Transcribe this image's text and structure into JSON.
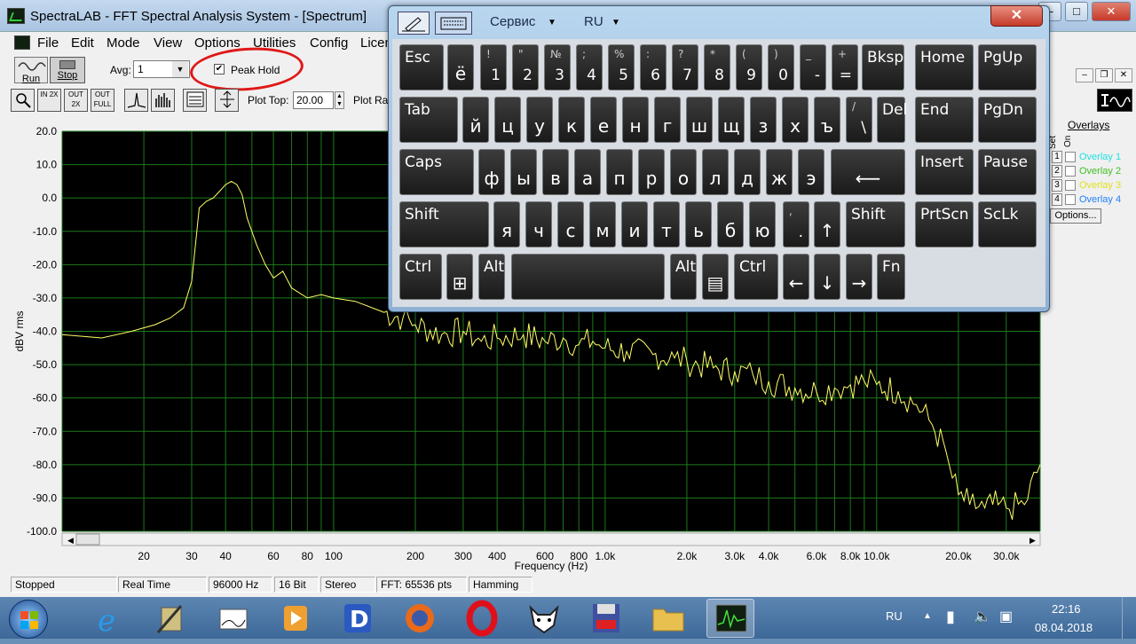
{
  "window": {
    "title": "SpectraLAB - FFT Spectral Analysis System - [Spectrum]",
    "min": "–",
    "max": "□",
    "close": "✕"
  },
  "menu": [
    "File",
    "Edit",
    "Mode",
    "View",
    "Options",
    "Utilities",
    "Config",
    "Licen"
  ],
  "toolbar": {
    "run": "Run",
    "stop": "Stop",
    "avg_label": "Avg:",
    "avg_value": "1",
    "peak_hold_label": "Peak Hold",
    "peak_hold_checked": "✔",
    "plot_top_label": "Plot Top:",
    "plot_top_value": "20.00",
    "plot_range_label": "Plot Ra",
    "zoom_buttons": [
      "IN 2X",
      "OUT 2X",
      "OUT FULL"
    ]
  },
  "overlays": {
    "header": "Overlays",
    "set_label": "Set",
    "on_label": "On",
    "items": [
      {
        "num": "1",
        "label": "Overlay 1",
        "color": "#20e0e0"
      },
      {
        "num": "2",
        "label": "Overlay 2",
        "color": "#40c020"
      },
      {
        "num": "3",
        "label": "Overlay 3",
        "color": "#e0e020"
      },
      {
        "num": "4",
        "label": "Overlay 4",
        "color": "#2080ff"
      }
    ],
    "options_label": "Options..."
  },
  "chart_data": {
    "type": "line",
    "ylabel": "dBV rms",
    "xlabel": "Frequency (Hz)",
    "ylim": [
      -100,
      20
    ],
    "xlim": [
      10,
      40000
    ],
    "xscale": "log",
    "y_ticks": [
      "20.0",
      "10.0",
      "0.0",
      "-10.0",
      "-20.0",
      "-30.0",
      "-40.0",
      "-50.0",
      "-60.0",
      "-70.0",
      "-80.0",
      "-90.0",
      "-100.0"
    ],
    "x_ticks": [
      {
        "v": 20,
        "label": "20"
      },
      {
        "v": 30,
        "label": "30"
      },
      {
        "v": 40,
        "label": "40"
      },
      {
        "v": 60,
        "label": "60"
      },
      {
        "v": 80,
        "label": "80"
      },
      {
        "v": 100,
        "label": "100"
      },
      {
        "v": 200,
        "label": "200"
      },
      {
        "v": 300,
        "label": "300"
      },
      {
        "v": 400,
        "label": "400"
      },
      {
        "v": 600,
        "label": "600"
      },
      {
        "v": 800,
        "label": "800"
      },
      {
        "v": 1000,
        "label": "1.0k"
      },
      {
        "v": 2000,
        "label": "2.0k"
      },
      {
        "v": 3000,
        "label": "3.0k"
      },
      {
        "v": 4000,
        "label": "4.0k"
      },
      {
        "v": 6000,
        "label": "6.0k"
      },
      {
        "v": 8000,
        "label": "8.0k"
      },
      {
        "v": 10000,
        "label": "10.0k"
      },
      {
        "v": 20000,
        "label": "20.0k"
      },
      {
        "v": 30000,
        "label": "30.0k"
      }
    ],
    "grid": true,
    "series": [
      {
        "color": "#ffff66",
        "x": [
          10,
          14,
          18,
          22,
          25,
          28,
          30,
          32,
          34,
          36,
          38,
          40,
          42,
          44,
          46,
          48,
          52,
          56,
          60,
          65,
          70,
          80,
          90,
          100,
          120,
          150,
          180,
          200,
          250,
          300,
          350,
          400,
          500,
          600,
          700,
          800,
          900,
          1000,
          1200,
          1500,
          1800,
          2000,
          2500,
          3000,
          3500,
          4000,
          5000,
          6000,
          7000,
          8000,
          9000,
          10000,
          12000,
          14000,
          16000,
          18000,
          19000,
          20000,
          22000,
          25000,
          28000,
          30000,
          35000,
          40000
        ],
        "y": [
          -41,
          -42,
          -40,
          -38,
          -36,
          -33,
          -25,
          -3,
          -1,
          0,
          2,
          4,
          5,
          4,
          1,
          -6,
          -14,
          -20,
          -24,
          -22,
          -27,
          -30,
          -29,
          -30,
          -31,
          -34,
          -36,
          -38,
          -41,
          -40,
          -43,
          -42,
          -41,
          -43,
          -42,
          -44,
          -43,
          -45,
          -46,
          -47,
          -48,
          -49,
          -51,
          -52,
          -53,
          -55,
          -57,
          -58,
          -57,
          -56,
          -55,
          -56,
          -58,
          -62,
          -68,
          -76,
          -84,
          -89,
          -92,
          -93,
          -92,
          -93,
          -92,
          -80
        ]
      }
    ]
  },
  "status": [
    "Stopped",
    "Real Time",
    "96000 Hz",
    "16 Bit",
    "Stereo",
    "FFT: 65536 pts",
    "Hamming"
  ],
  "osk": {
    "menu1": "Сервис",
    "menu2": "RU",
    "close": "✕",
    "rows": [
      [
        {
          "m": "Esc"
        },
        {
          "m": "ё"
        },
        {
          "t": "!",
          "b": "1"
        },
        {
          "t": "\"",
          "b": "2"
        },
        {
          "t": "№",
          "b": "3"
        },
        {
          "t": ";",
          "b": "4"
        },
        {
          "t": "%",
          "b": "5"
        },
        {
          "t": ":",
          "b": "6"
        },
        {
          "t": "?",
          "b": "7"
        },
        {
          "t": "*",
          "b": "8"
        },
        {
          "t": "(",
          "b": "9"
        },
        {
          "t": ")",
          "b": "0"
        },
        {
          "t": "_",
          "b": "-"
        },
        {
          "t": "+",
          "b": "="
        },
        {
          "m": "Bksp"
        },
        {
          "m": "Home"
        },
        {
          "m": "PgUp"
        }
      ],
      [
        {
          "m": "Tab"
        },
        {
          "m": "й"
        },
        {
          "m": "ц"
        },
        {
          "m": "у"
        },
        {
          "m": "к"
        },
        {
          "m": "е"
        },
        {
          "m": "н"
        },
        {
          "m": "г"
        },
        {
          "m": "ш"
        },
        {
          "m": "щ"
        },
        {
          "m": "з"
        },
        {
          "m": "х"
        },
        {
          "m": "ъ"
        },
        {
          "t": "/",
          "b": "\\"
        },
        {
          "m": "Del"
        },
        {
          "m": "End"
        },
        {
          "m": "PgDn"
        }
      ],
      [
        {
          "m": "Caps"
        },
        {
          "m": "ф"
        },
        {
          "m": "ы"
        },
        {
          "m": "в"
        },
        {
          "m": "а"
        },
        {
          "m": "п"
        },
        {
          "m": "р"
        },
        {
          "m": "о"
        },
        {
          "m": "л"
        },
        {
          "m": "д"
        },
        {
          "m": "ж"
        },
        {
          "m": "э"
        },
        {
          "m": "⟵"
        },
        {
          "m": "Insert"
        },
        {
          "m": "Pause"
        }
      ],
      [
        {
          "m": "Shift"
        },
        {
          "m": "я"
        },
        {
          "m": "ч"
        },
        {
          "m": "с"
        },
        {
          "m": "м"
        },
        {
          "m": "и"
        },
        {
          "m": "т"
        },
        {
          "m": "ь"
        },
        {
          "m": "б"
        },
        {
          "m": "ю"
        },
        {
          "t": ",",
          "b": "."
        },
        {
          "m": "↑"
        },
        {
          "m": "Shift"
        },
        {
          "m": "PrtScn"
        },
        {
          "m": "ScLk"
        }
      ],
      [
        {
          "m": "Ctrl"
        },
        {
          "m": "⊞"
        },
        {
          "m": "Alt"
        },
        {
          "m": ""
        },
        {
          "m": "Alt"
        },
        {
          "m": "▤"
        },
        {
          "m": "Ctrl"
        },
        {
          "m": "←"
        },
        {
          "m": "↓"
        },
        {
          "m": "→"
        },
        {
          "m": "Fn"
        }
      ]
    ]
  },
  "tray": {
    "lang": "RU",
    "time": "22:16",
    "date": "08.04.2018"
  }
}
